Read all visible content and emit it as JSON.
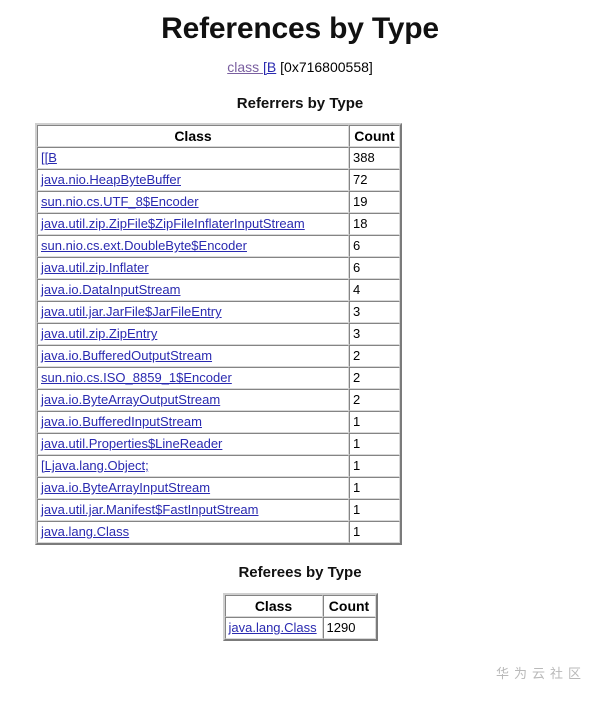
{
  "document": {
    "title": "References by Type",
    "object_ref": {
      "link_text": "class ",
      "class_link_text": "[B",
      "address": " [0x716800558]"
    }
  },
  "referrers_section": {
    "heading": "Referrers by Type",
    "columns": [
      "Class",
      "Count"
    ],
    "rows": [
      {
        "class": "[[B",
        "count": "388"
      },
      {
        "class": "java.nio.HeapByteBuffer",
        "count": "72"
      },
      {
        "class": "sun.nio.cs.UTF_8$Encoder",
        "count": "19"
      },
      {
        "class": "java.util.zip.ZipFile$ZipFileInflaterInputStream",
        "count": "18"
      },
      {
        "class": "sun.nio.cs.ext.DoubleByte$Encoder",
        "count": "6"
      },
      {
        "class": "java.util.zip.Inflater",
        "count": "6"
      },
      {
        "class": "java.io.DataInputStream",
        "count": "4"
      },
      {
        "class": "java.util.jar.JarFile$JarFileEntry",
        "count": "3"
      },
      {
        "class": "java.util.zip.ZipEntry",
        "count": "3"
      },
      {
        "class": "java.io.BufferedOutputStream",
        "count": "2"
      },
      {
        "class": "sun.nio.cs.ISO_8859_1$Encoder",
        "count": "2"
      },
      {
        "class": "java.io.ByteArrayOutputStream",
        "count": "2"
      },
      {
        "class": "java.io.BufferedInputStream",
        "count": "1"
      },
      {
        "class": "java.util.Properties$LineReader",
        "count": "1"
      },
      {
        "class": "[Ljava.lang.Object;",
        "count": "1"
      },
      {
        "class": "java.io.ByteArrayInputStream",
        "count": "1"
      },
      {
        "class": "java.util.jar.Manifest$FastInputStream",
        "count": "1"
      },
      {
        "class": "java.lang.Class",
        "count": "1"
      }
    ]
  },
  "referees_section": {
    "heading": "Referees by Type",
    "columns": [
      "Class",
      "Count"
    ],
    "rows": [
      {
        "class": "java.lang.Class",
        "count": "1290"
      }
    ]
  },
  "watermark": {
    "text": "华为云社区"
  },
  "colors": {
    "link": "#2a2ab0",
    "visited_link": "#7a5fa0",
    "text": "#000000",
    "background": "#ffffff",
    "watermark": "#b9b9b9"
  }
}
